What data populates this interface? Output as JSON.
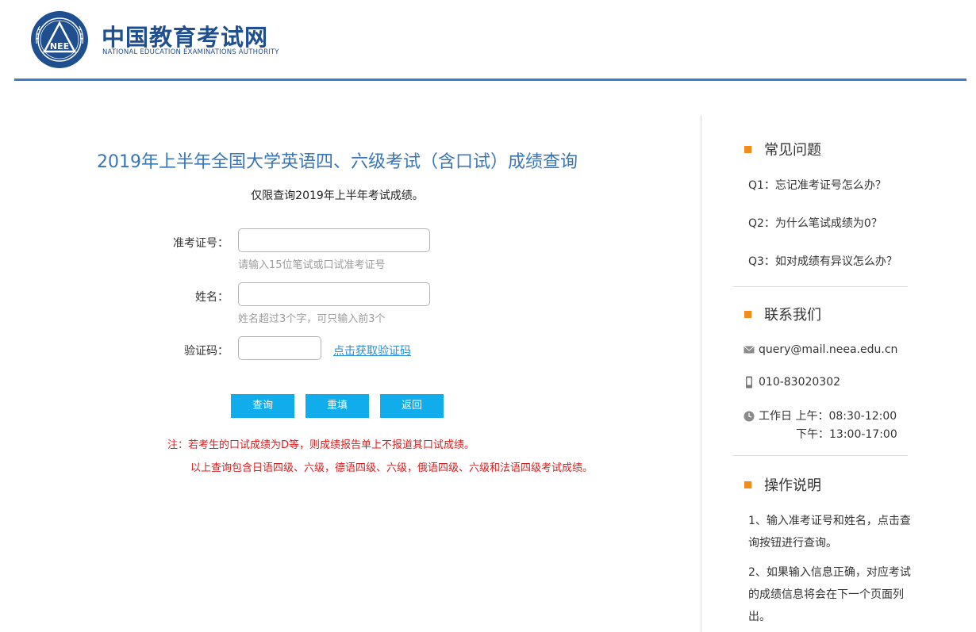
{
  "header": {
    "logo_text": "NEE",
    "brand_cn": "中国教育考试网",
    "brand_en": "NATIONAL EDUCATION EXAMINATIONS AUTHORITY"
  },
  "main": {
    "title": "2019年上半年全国大学英语四、六级考试（含口试）成绩查询",
    "notice": "仅限查询2019年上半年考试成绩。",
    "form": {
      "ticket_label": "准考证号：",
      "ticket_value": "",
      "ticket_hint": "请输入15位笔试或口试准考证号",
      "name_label": "姓名：",
      "name_value": "",
      "name_hint": "姓名超过3个字，可只输入前3个",
      "captcha_label": "验证码：",
      "captcha_value": "",
      "captcha_link": "点击获取验证码"
    },
    "buttons": {
      "query": "查询",
      "reset": "重填",
      "back": "返回"
    },
    "notes": {
      "line1": "注：若考生的口试成绩为D等，则成绩报告单上不报道其口试成绩。",
      "line2": "以上查询包含日语四级、六级，德语四级、六级，俄语四级、六级和法语四级考试成绩。"
    }
  },
  "sidebar": {
    "faq": {
      "title": "常见问题",
      "items": [
        "Q1：忘记准考证号怎么办？",
        "Q2：为什么笔试成绩为0？",
        "Q3：如对成绩有异议怎么办？"
      ]
    },
    "contact": {
      "title": "联系我们",
      "email": "query@mail.neea.edu.cn",
      "phone": "010-83020302",
      "hours_am": "工作日 上午：08:30-12:00",
      "hours_pm": "下午：13:00-17:00"
    },
    "instructions": {
      "title": "操作说明",
      "step1": "1、输入准考证号和姓名，点击查询按钮进行查询。",
      "step2": "2、如果输入信息正确，对应考试的成绩信息将会在下一个页面列出。"
    }
  },
  "colors": {
    "brand": "#1f4f8f",
    "title_blue": "#3876b8",
    "button": "#10acec",
    "note_red": "#d81e1e",
    "accent_orange": "#f08c1a"
  }
}
